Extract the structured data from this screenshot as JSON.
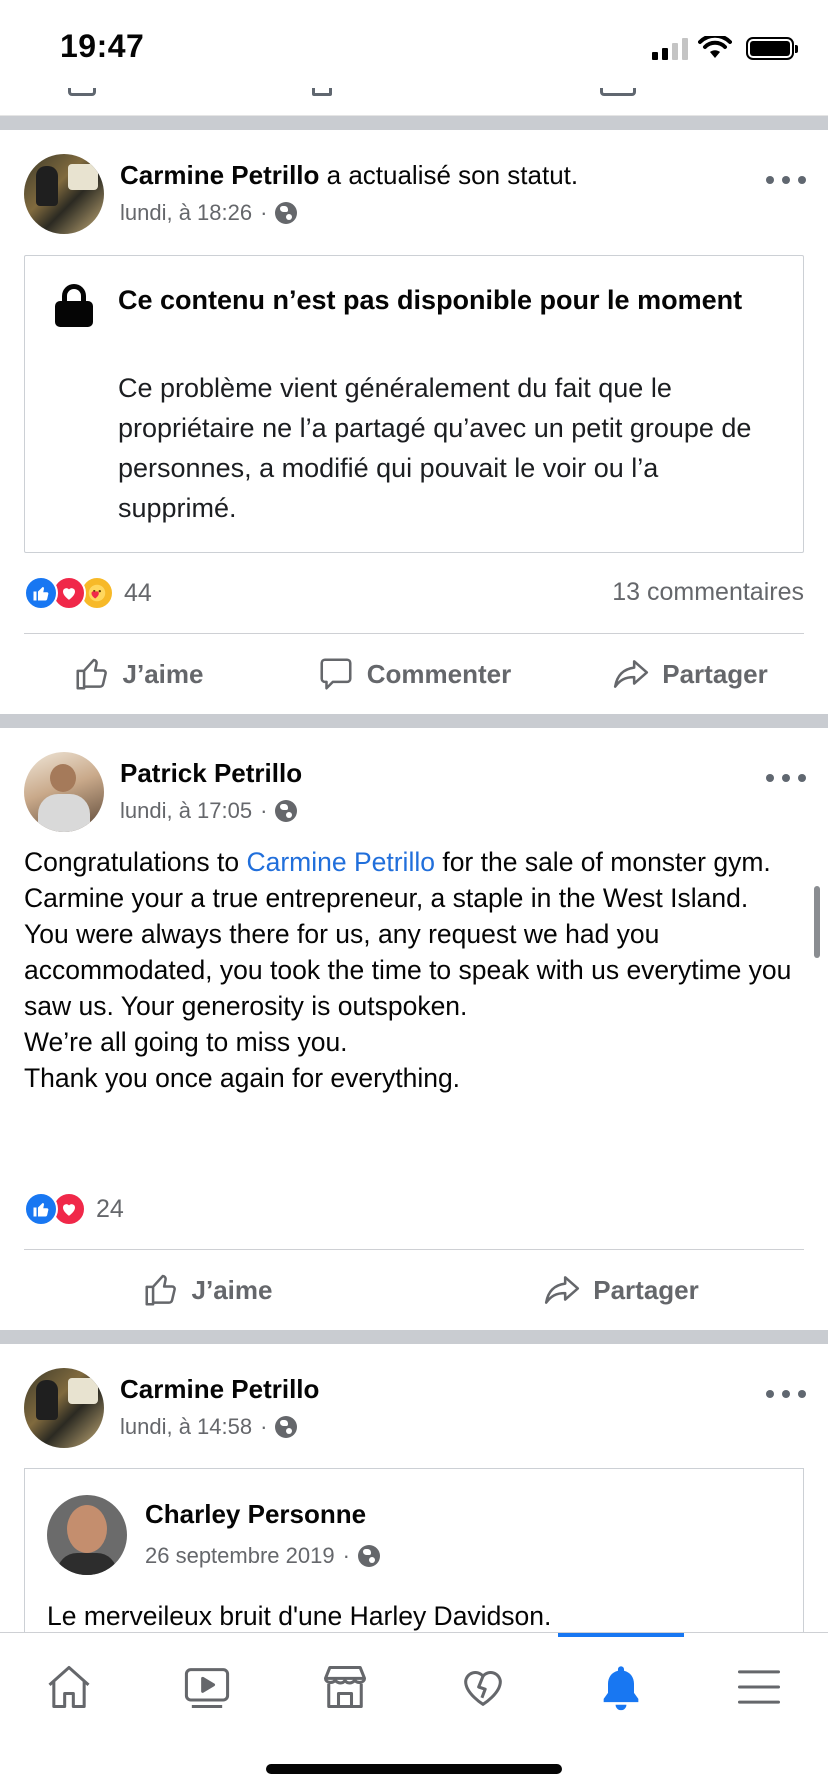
{
  "status_bar": {
    "time": "19:47"
  },
  "posts": [
    {
      "author": "Carmine Petrillo",
      "action": " a actualisé son statut.",
      "time": "lundi, à 18:26",
      "separator": " ·",
      "unavailable": {
        "title": "Ce contenu n’est pas disponible pour le moment",
        "message": "Ce problème vient généralement du fait que le propriétaire ne l’a partagé qu’avec un petit groupe de personnes, a modifié qui pouvait le voir ou l’a supprimé."
      },
      "reactions": {
        "count": "44",
        "types": [
          "like",
          "love",
          "care"
        ]
      },
      "comments": "13 commentaires",
      "actions": [
        "J’aime",
        "Commenter",
        "Partager"
      ]
    },
    {
      "author": "Patrick Petrillo",
      "time": "lundi, à 17:05",
      "separator": " ·",
      "text_before_mention": "Congratulations to ",
      "mention": "Carmine Petrillo",
      "text_after_mention": " for the sale of monster gym.",
      "text_lines": [
        "Carmine your a true entrepreneur, a staple in the West Island.",
        "You were always there for us, any request we had you accommodated, you took the time to speak with us everytime you saw us. Your generosity is outspoken.",
        "We’re all going to miss you.",
        "Thank you once again for everything."
      ],
      "reactions": {
        "count": "24",
        "types": [
          "like",
          "love"
        ]
      },
      "actions": [
        "J’aime",
        "Partager"
      ]
    },
    {
      "author": "Carmine Petrillo",
      "time": "lundi, à 14:58",
      "separator": " ·",
      "shared": {
        "author": "Charley Personne",
        "time": "26 septembre 2019",
        "separator": " ·",
        "text": "Le merveileux bruit d'une Harley Davidson."
      }
    }
  ],
  "nav": {
    "items": [
      "home-icon",
      "video-icon",
      "marketplace-icon",
      "dating-icon",
      "notifications-icon",
      "menu-icon"
    ],
    "active": "notifications-icon",
    "active_color": "#1877f2"
  }
}
